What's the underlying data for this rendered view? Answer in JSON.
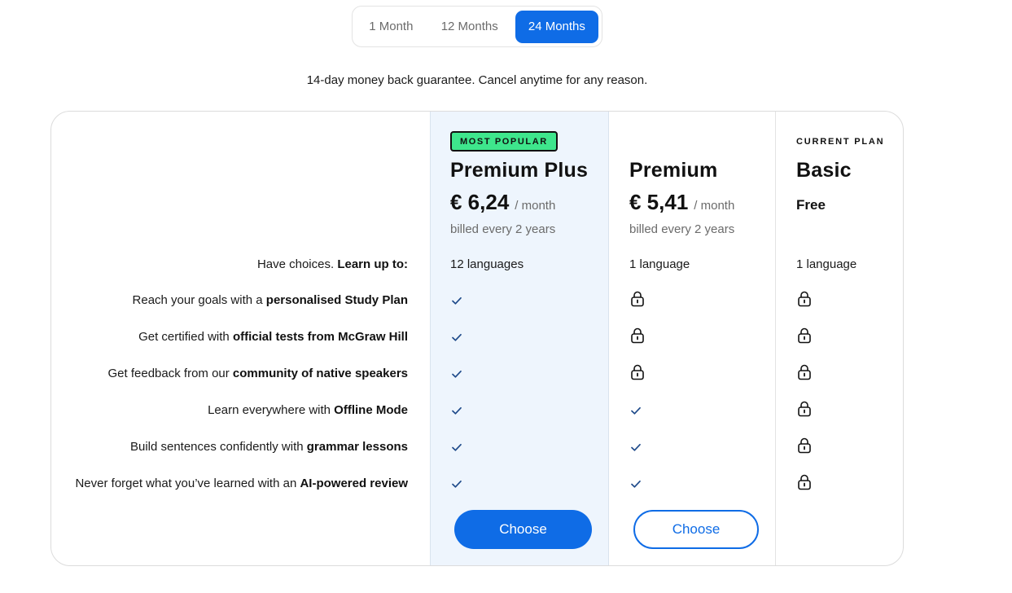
{
  "durations": [
    {
      "label": "1 Month",
      "selected": false
    },
    {
      "label": "12 Months",
      "selected": false
    },
    {
      "label": "24 Months",
      "selected": true
    }
  ],
  "guarantee": "14-day money back guarantee. Cancel anytime for any reason.",
  "plans": [
    {
      "badge": "MOST POPULAR",
      "name": "Premium Plus",
      "price": "€ 6,24",
      "per": "/ month",
      "billed": "billed every 2 years",
      "languages": "12 languages",
      "button": "Choose"
    },
    {
      "name": "Premium",
      "price": "€ 5,41",
      "per": "/ month",
      "billed": "billed every 2 years",
      "languages": "1 language",
      "button": "Choose"
    },
    {
      "label": "CURRENT PLAN",
      "name": "Basic",
      "price": "Free",
      "languages": "1 language"
    }
  ],
  "features": [
    {
      "prefix": "Have choices. ",
      "bold": "Learn up to:"
    },
    {
      "prefix": "Reach your goals with a ",
      "bold": "personalised Study Plan",
      "availability": [
        "check",
        "lock",
        "lock"
      ]
    },
    {
      "prefix": "Get certified with ",
      "bold": "official tests from McGraw Hill",
      "availability": [
        "check",
        "lock",
        "lock"
      ]
    },
    {
      "prefix": "Get feedback from our ",
      "bold": "community of native speakers",
      "availability": [
        "check",
        "lock",
        "lock"
      ]
    },
    {
      "prefix": "Learn everywhere with ",
      "bold": "Offline Mode",
      "availability": [
        "check",
        "check",
        "lock"
      ]
    },
    {
      "prefix": "Build sentences confidently with ",
      "bold": "grammar lessons",
      "availability": [
        "check",
        "check",
        "lock"
      ]
    },
    {
      "prefix": "Never forget what you’ve learned with an ",
      "bold": "AI-powered review",
      "availability": [
        "check",
        "check",
        "lock"
      ]
    }
  ],
  "colors": {
    "accent": "#0f6ce6",
    "badge_green": "#3ee68c",
    "highlight_bg": "#eef5fd"
  },
  "icons": {
    "check": "check-icon",
    "lock": "lock-icon"
  }
}
